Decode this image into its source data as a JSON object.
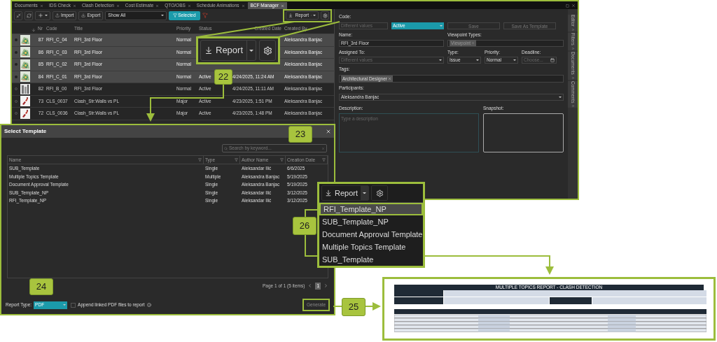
{
  "tabs": [
    {
      "label": "Documents",
      "selected": false
    },
    {
      "label": "IDS Check",
      "selected": false
    },
    {
      "label": "Clash Detection",
      "selected": false
    },
    {
      "label": "Cost Estimate",
      "selected": false
    },
    {
      "label": "QTO/OBS",
      "selected": false
    },
    {
      "label": "Schedule Animations",
      "selected": false
    },
    {
      "label": "BCF Manager",
      "selected": true
    }
  ],
  "toolbar": {
    "import_label": "Import",
    "export_label": "Export",
    "view_filter": "Show All",
    "selected_filter": {
      "label": "Selected",
      "on": true
    },
    "report_label": "Report"
  },
  "table": {
    "columns": [
      "Nr",
      "Code",
      "Title",
      "Priority",
      "Status",
      "Created Date",
      "Created By"
    ],
    "rows": [
      {
        "selected": true,
        "nr": "87",
        "code": "RFI_C_04",
        "title": "RFI_3rd Floor",
        "priority": "Normal",
        "created_by": "Aleksandra Banjac"
      },
      {
        "selected": true,
        "nr": "86",
        "code": "RFI_C_03",
        "title": "RFI_3rd Floor",
        "priority": "Normal",
        "created_by": "Aleksandra Banjac"
      },
      {
        "selected": true,
        "nr": "85",
        "code": "RFI_C_02",
        "title": "RFI_3rd Floor",
        "priority": "Normal",
        "created_by": "Aleksandra Banjac"
      },
      {
        "selected": true,
        "nr": "84",
        "code": "RFI_C_01",
        "title": "RFI_3rd Floor",
        "priority": "Normal",
        "status": "Active",
        "created_date": "4/24/2025, 11:24 AM",
        "created_by": "Aleksandra Banjac"
      },
      {
        "selected": false,
        "nr": "82",
        "code": "RFI_B_00",
        "title": "RFI_3rd Floor",
        "priority": "Normal",
        "status": "Active",
        "created_date": "4/24/2025, 11:11 AM",
        "created_by": "Aleksandra Banjac"
      },
      {
        "selected": false,
        "nr": "73",
        "code": "CLS_0037",
        "title": "Clash_Str:Walls vs PL",
        "priority": "Major",
        "status": "Active",
        "created_date": "4/23/2025, 1:51 PM",
        "created_by": "Aleksandra Banjac"
      },
      {
        "selected": false,
        "nr": "72",
        "code": "CLS_0036",
        "title": "Clash_Str:Walls vs PL",
        "priority": "Major",
        "status": "Active",
        "created_date": "4/23/2025, 1:48 PM",
        "created_by": "Aleksandra Banjac"
      }
    ]
  },
  "editor": {
    "code_label": "Code:",
    "code_placeholder": "Different values",
    "status": "Active",
    "save": "Save",
    "save_as_template": "Save As Template",
    "name_label": "Name:",
    "name_value": "RFI_3rd Floor",
    "viewpoint_label": "Viewpoint Types:",
    "viewpoint_tags": [
      "Viewpoint"
    ],
    "assigned_label": "Assigned To:",
    "assigned_placeholder": "Different values",
    "type_label": "Type:",
    "type_value": "Issue",
    "priority_label": "Priority:",
    "priority_value": "Normal",
    "deadline_label": "Deadline:",
    "deadline_placeholder": "Choose...",
    "tags_label": "Tags:",
    "tags": [
      "Architectural Designer"
    ],
    "participants_label": "Participants:",
    "participants_value": "Aleksandra Banjac",
    "description_label": "Description:",
    "description_placeholder": "Type a description",
    "snapshot_label": "Snapshot:"
  },
  "side_tabs": [
    "Editor",
    "Filters",
    "Documents",
    "Comments"
  ],
  "report_zoom": {
    "label": "Report"
  },
  "dialog": {
    "title": "Select Template",
    "search_placeholder": "Search by keyword...",
    "columns": [
      "Name",
      "Type",
      "Author Name",
      "Creation Date"
    ],
    "rows": [
      {
        "name": "SUB_Template",
        "type": "Single",
        "author": "Aleksandar Ilić",
        "date": "6/6/2025"
      },
      {
        "name": "Multiple Topics Template",
        "type": "Multiple",
        "author": "Aleksandra Banjac",
        "date": "5/19/2025"
      },
      {
        "name": "Document Approval Template",
        "type": "Single",
        "author": "Aleksandra Banjac",
        "date": "5/19/2025"
      },
      {
        "name": "SUB_Template_NP",
        "type": "Single",
        "author": "Aleksandar Ilić",
        "date": "3/12/2025"
      },
      {
        "name": "RFI_Template_NP",
        "type": "Single",
        "author": "Aleksandar Ilić",
        "date": "3/12/2025"
      }
    ],
    "pager": "Page 1 of 1 (5 items)",
    "page": "1",
    "report_type_label": "Report Type:",
    "report_type": "PDF",
    "append_label": "Append linked PDF files to report",
    "append_checked": false,
    "generate": "Generate"
  },
  "dropdown": {
    "button": "Report",
    "items": [
      {
        "label": "RFI_Template_NP",
        "selected": true
      },
      {
        "label": "SUB_Template_NP",
        "selected": false
      },
      {
        "label": "Document Approval Template",
        "selected": false
      },
      {
        "label": "Multiple Topics Template",
        "selected": false
      },
      {
        "label": "SUB_Template",
        "selected": false
      }
    ]
  },
  "badges": [
    "22",
    "23",
    "24",
    "25",
    "26"
  ],
  "report_preview": {
    "title": "MULTIPLE TOPICS REPORT - CLASH DETECTION"
  }
}
